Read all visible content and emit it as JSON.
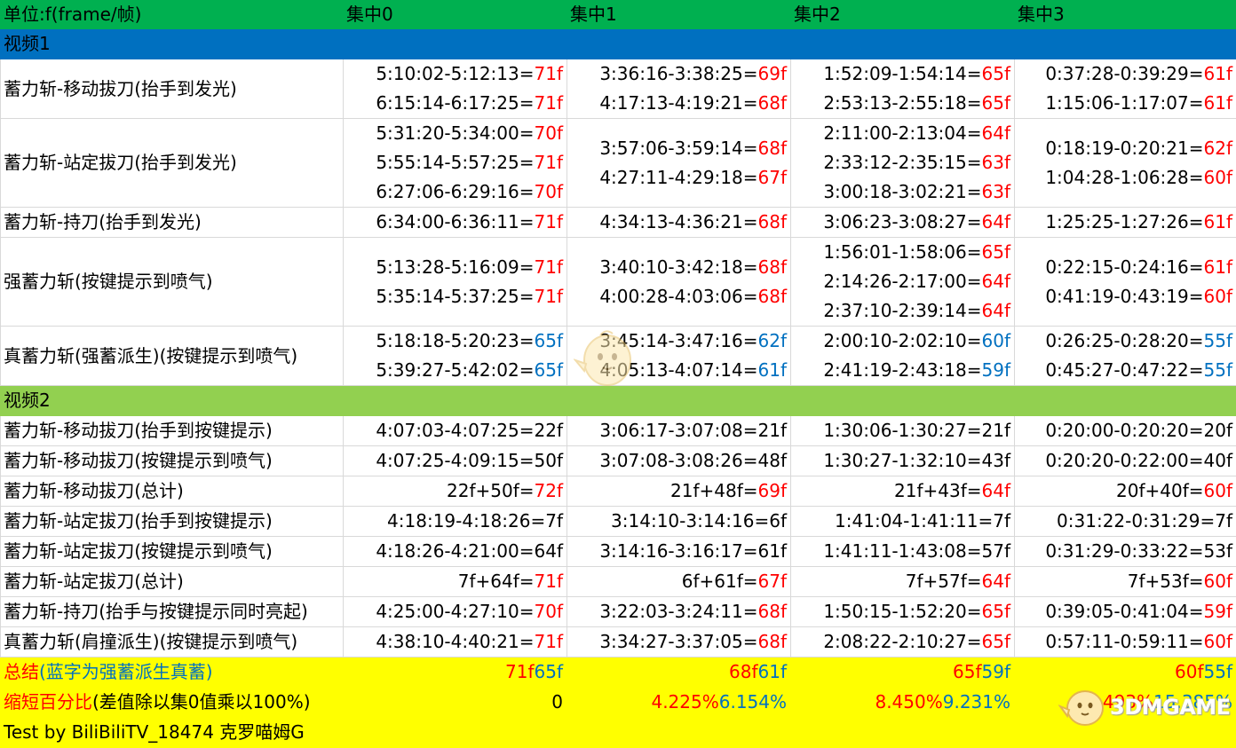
{
  "header": {
    "unit_label": "单位:f(frame/帧)",
    "col0": "集中0",
    "col1": "集中1",
    "col2": "集中2",
    "col3": "集中3"
  },
  "section1": {
    "title": "视频1",
    "rows": [
      {
        "label": "蓄力斩-移动拔刀(抬手到发光)",
        "cells": [
          [
            {
              "range": "5:10:02-5:12:13=",
              "frames": "71f"
            },
            {
              "range": "6:15:14-6:17:25=",
              "frames": "71f"
            }
          ],
          [
            {
              "range": "3:36:16-3:38:25=",
              "frames": "69f"
            },
            {
              "range": "4:17:13-4:19:21=",
              "frames": "68f"
            }
          ],
          [
            {
              "range": "1:52:09-1:54:14=",
              "frames": "65f"
            },
            {
              "range": "2:53:13-2:55:18=",
              "frames": "65f"
            }
          ],
          [
            {
              "range": "0:37:28-0:39:29=",
              "frames": "61f"
            },
            {
              "range": "1:15:06-1:17:07=",
              "frames": "61f"
            }
          ]
        ]
      },
      {
        "label": "蓄力斩-站定拔刀(抬手到发光)",
        "cells": [
          [
            {
              "range": "5:31:20-5:34:00=",
              "frames": "70f"
            },
            {
              "range": "5:55:14-5:57:25=",
              "frames": "71f"
            },
            {
              "range": "6:27:06-6:29:16=",
              "frames": "70f"
            }
          ],
          [
            {
              "range": "3:57:06-3:59:14=",
              "frames": "68f"
            },
            {
              "range": "4:27:11-4:29:18=",
              "frames": "67f"
            }
          ],
          [
            {
              "range": "2:11:00-2:13:04=",
              "frames": "64f"
            },
            {
              "range": "2:33:12-2:35:15=",
              "frames": "63f"
            },
            {
              "range": "3:00:18-3:02:21=",
              "frames": "63f"
            }
          ],
          [
            {
              "range": "0:18:19-0:20:21=",
              "frames": "62f"
            },
            {
              "range": "1:04:28-1:06:28=",
              "frames": "60f"
            }
          ]
        ]
      },
      {
        "label": "蓄力斩-持刀(抬手到发光)",
        "cells": [
          [
            {
              "range": "6:34:00-6:36:11=",
              "frames": "71f"
            }
          ],
          [
            {
              "range": "4:34:13-4:36:21=",
              "frames": "68f"
            }
          ],
          [
            {
              "range": "3:06:23-3:08:27=",
              "frames": "64f"
            }
          ],
          [
            {
              "range": "1:25:25-1:27:26=",
              "frames": "61f"
            }
          ]
        ]
      },
      {
        "label": "强蓄力斩(按键提示到喷气)",
        "cells": [
          [
            {
              "range": "5:13:28-5:16:09=",
              "frames": "71f"
            },
            {
              "range": "5:35:14-5:37:25=",
              "frames": "71f"
            }
          ],
          [
            {
              "range": "3:40:10-3:42:18=",
              "frames": "68f"
            },
            {
              "range": "4:00:28-4:03:06=",
              "frames": "68f"
            }
          ],
          [
            {
              "range": "1:56:01-1:58:06=",
              "frames": "65f"
            },
            {
              "range": "2:14:26-2:17:00=",
              "frames": "64f"
            },
            {
              "range": "2:37:10-2:39:14=",
              "frames": "64f"
            }
          ],
          [
            {
              "range": "0:22:15-0:24:16=",
              "frames": "61f"
            },
            {
              "range": "0:41:19-0:43:19=",
              "frames": "60f"
            }
          ]
        ]
      },
      {
        "label": "真蓄力斩(强蓄派生)(按键提示到喷气)",
        "blue": true,
        "cells": [
          [
            {
              "range": "5:18:18-5:20:23=",
              "frames": "65f"
            },
            {
              "range": "5:39:27-5:42:02=",
              "frames": "65f"
            }
          ],
          [
            {
              "range": "3:45:14-3:47:16=",
              "frames": "62f"
            },
            {
              "range": "4:05:13-4:07:14=",
              "frames": "61f"
            }
          ],
          [
            {
              "range": "2:00:10-2:02:10=",
              "frames": "60f"
            },
            {
              "range": "2:41:19-2:43:18=",
              "frames": "59f"
            }
          ],
          [
            {
              "range": "0:26:25-0:28:20=",
              "frames": "55f"
            },
            {
              "range": "0:45:27-0:47:22=",
              "frames": "55f"
            }
          ]
        ]
      }
    ]
  },
  "section2": {
    "title": "视频2",
    "rows": [
      {
        "label": "蓄力斩-移动拔刀(抬手到按键提示)",
        "plain": true,
        "cells": [
          {
            "range": "4:07:03-4:07:25=22f",
            "frames": ""
          },
          {
            "range": "3:06:17-3:07:08=21f",
            "frames": ""
          },
          {
            "range": "1:30:06-1:30:27=21f",
            "frames": ""
          },
          {
            "range": "0:20:00-0:20:20=20f",
            "frames": ""
          }
        ]
      },
      {
        "label": "蓄力斩-移动拔刀(按键提示到喷气)",
        "plain": true,
        "cells": [
          {
            "range": "4:07:25-4:09:15=50f",
            "frames": ""
          },
          {
            "range": "3:07:08-3:08:26=48f",
            "frames": ""
          },
          {
            "range": "1:30:27-1:32:10=43f",
            "frames": ""
          },
          {
            "range": "0:20:20-0:22:00=40f",
            "frames": ""
          }
        ]
      },
      {
        "label": "蓄力斩-移动拔刀(总计)",
        "cells": [
          {
            "range": "22f+50f=",
            "frames": "72f"
          },
          {
            "range": "21f+48f=",
            "frames": "69f"
          },
          {
            "range": "21f+43f=",
            "frames": "64f"
          },
          {
            "range": "20f+40f=",
            "frames": "60f"
          }
        ]
      },
      {
        "label": "蓄力斩-站定拔刀(抬手到按键提示)",
        "plain": true,
        "cells": [
          {
            "range": "4:18:19-4:18:26=7f",
            "frames": ""
          },
          {
            "range": "3:14:10-3:14:16=6f",
            "frames": ""
          },
          {
            "range": "1:41:04-1:41:11=7f",
            "frames": ""
          },
          {
            "range": "0:31:22-0:31:29=7f",
            "frames": ""
          }
        ]
      },
      {
        "label": "蓄力斩-站定拔刀(按键提示到喷气)",
        "plain": true,
        "cells": [
          {
            "range": "4:18:26-4:21:00=64f",
            "frames": ""
          },
          {
            "range": "3:14:16-3:16:17=61f",
            "frames": ""
          },
          {
            "range": "1:41:11-1:43:08=57f",
            "frames": ""
          },
          {
            "range": "0:31:29-0:33:22=53f",
            "frames": ""
          }
        ]
      },
      {
        "label": "蓄力斩-站定拔刀(总计)",
        "cells": [
          {
            "range": "7f+64f=",
            "frames": "71f"
          },
          {
            "range": "6f+61f=",
            "frames": "67f"
          },
          {
            "range": "7f+57f=",
            "frames": "64f"
          },
          {
            "range": "7f+53f=",
            "frames": "60f"
          }
        ]
      },
      {
        "label": "蓄力斩-持刀(抬手与按键提示同时亮起)",
        "cells": [
          {
            "range": "4:25:00-4:27:10=",
            "frames": "70f"
          },
          {
            "range": "3:22:03-3:24:11=",
            "frames": "68f"
          },
          {
            "range": "1:50:15-1:52:20=",
            "frames": "65f"
          },
          {
            "range": "0:39:05-0:41:04=",
            "frames": "59f"
          }
        ]
      },
      {
        "label": "真蓄力斩(肩撞派生)(按键提示到喷气)",
        "cells": [
          {
            "range": "4:38:10-4:40:21=",
            "frames": "71f"
          },
          {
            "range": "3:34:27-3:37:05=",
            "frames": "68f"
          },
          {
            "range": "2:08:22-2:10:27=",
            "frames": "65f"
          },
          {
            "range": "0:57:11-0:59:11=",
            "frames": "60f"
          }
        ]
      }
    ]
  },
  "summary": {
    "total_label_red": "总结",
    "total_label_blue": "(蓝字为强蓄派生真蓄)",
    "totals": [
      {
        "red": "71f",
        "blue": "65f"
      },
      {
        "red": "68f",
        "blue": "61f"
      },
      {
        "red": "65f",
        "blue": "59f"
      },
      {
        "red": "60f",
        "blue": "55f"
      }
    ],
    "pct_label_red": "缩短百分比",
    "pct_label_black": "(差值除以集0值乘以100%)",
    "pcts": [
      {
        "red": "",
        "blue": "",
        "plain": "0"
      },
      {
        "red": "4.225%",
        "blue": "6.154%",
        "plain": ""
      },
      {
        "red": "8.450%",
        "blue": "9.231%",
        "plain": ""
      },
      {
        "red": "15.493%",
        "blue": "15.385%",
        "plain": ""
      }
    ],
    "credit": "Test by BiliBiliTV_18474 克罗喵姆G"
  },
  "watermark": {
    "logo_text": "3DMGAME",
    "icon": "mascot-icon"
  },
  "colors": {
    "header_green": "#00b050",
    "section1_blue": "#0070c0",
    "section2_green": "#92d050",
    "summary_yellow": "#ffff00",
    "frames_red": "#ff0000",
    "frames_blue": "#0070c0"
  }
}
